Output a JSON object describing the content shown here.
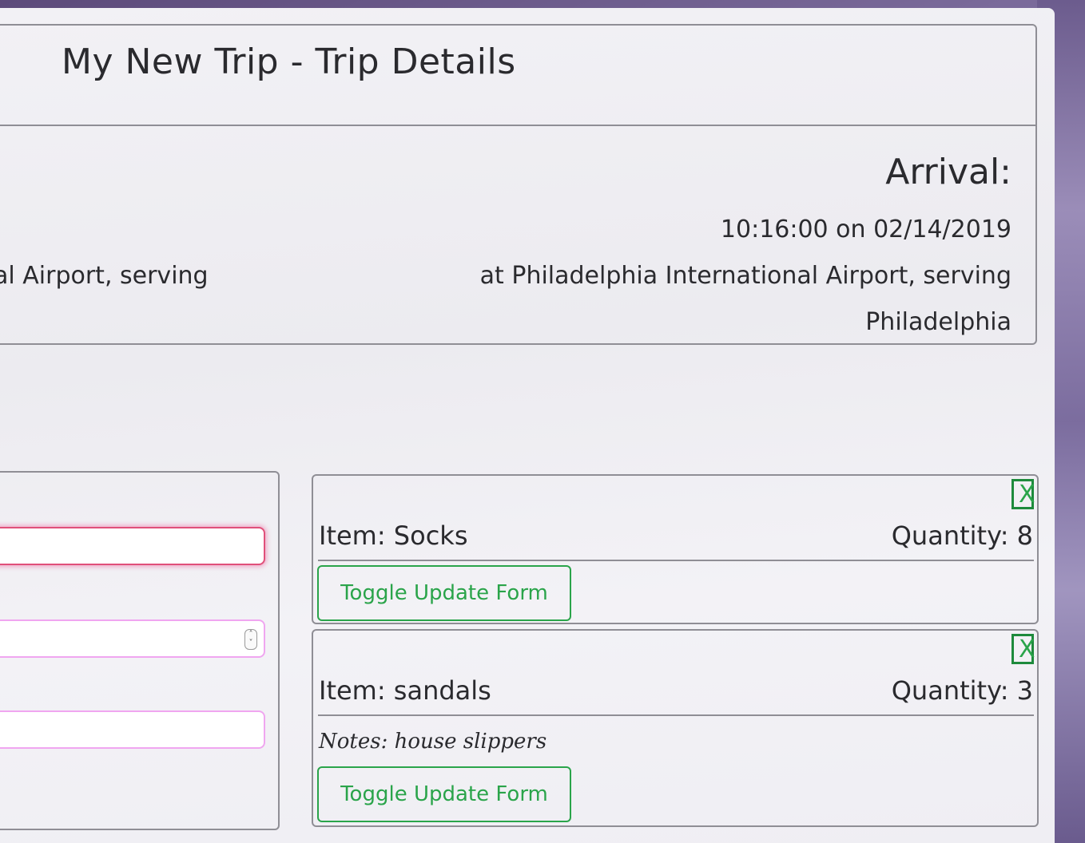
{
  "trip": {
    "title": "My New Trip - Trip Details",
    "departure": {
      "airport_fragment": "al Airport, serving"
    },
    "arrival": {
      "heading": "Arrival:",
      "time": "10:16:00 on 02/14/2019",
      "airport": "at Philadelphia International Airport, serving",
      "city": "Philadelphia"
    }
  },
  "items": [
    {
      "name": "Item: Socks",
      "quantity": "Quantity: 8",
      "notes": "",
      "delete_label": "X",
      "toggle_label": "Toggle Update Form"
    },
    {
      "name": "Item: sandals",
      "quantity": "Quantity: 3",
      "notes": "Notes: house slippers",
      "delete_label": "X",
      "toggle_label": "Toggle Update Form"
    }
  ],
  "colors": {
    "accent_green": "#2aa44a",
    "focus_border": "#e0507a",
    "input_border": "#f0a6f0",
    "panel_border": "#8f8e95"
  }
}
